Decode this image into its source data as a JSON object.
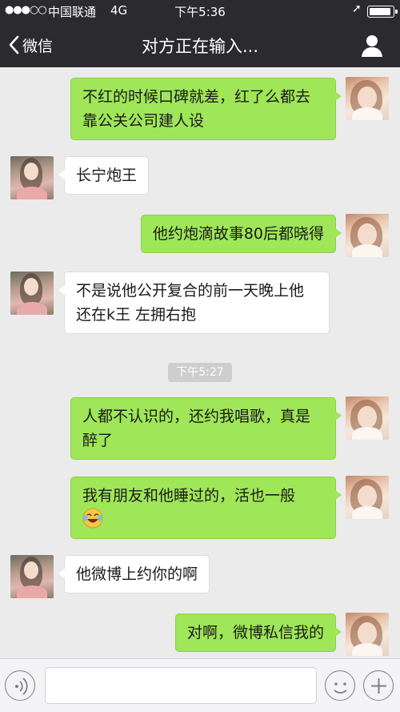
{
  "status_bar": {
    "signal": "●●●○○",
    "carrier": "中国联通",
    "network": "4G",
    "time": "下午5:36"
  },
  "nav": {
    "back_label": "微信",
    "title": "对方正在输入..."
  },
  "chat": {
    "messages": [
      {
        "side": "out",
        "text": "不红的时候口碑就差，红了么都去靠公关公司建人设"
      },
      {
        "side": "in",
        "text": "长宁炮王"
      },
      {
        "side": "out",
        "text": "他约炮滴故事80后都晓得"
      },
      {
        "side": "in",
        "text": "不是说他公开复合的前一天晚上他还在k王 左拥右抱"
      },
      {
        "side": "out",
        "text": "人都不认识的，还约我唱歌，真是醉了"
      },
      {
        "side": "out",
        "text": "我有朋友和他睡过的，活也一般",
        "emoji": "crying-laughing-emoji"
      },
      {
        "side": "in",
        "text": "他微博上约你的啊"
      },
      {
        "side": "out",
        "text": "对啊，微博私信我的"
      }
    ],
    "timestamp": "下午5:27"
  },
  "input_bar": {
    "input_value": ""
  },
  "colors": {
    "nav_bg": "#2b2b2f",
    "chat_bg": "#ebebeb",
    "outgoing_bubble": "#9fe658",
    "incoming_bubble": "#ffffff"
  }
}
